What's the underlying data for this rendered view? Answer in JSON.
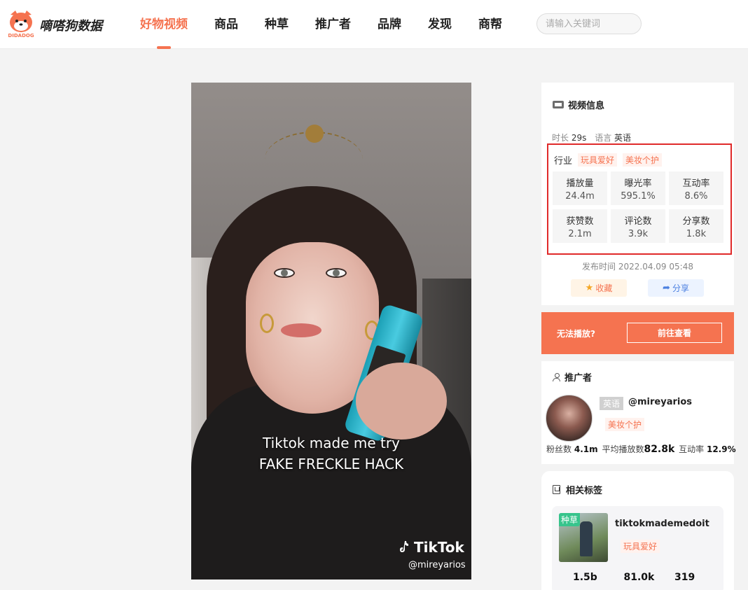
{
  "header": {
    "logo_text": "嘀嗒狗数据",
    "logo_sub": "DIDADOG",
    "nav": [
      {
        "label": "好物视频",
        "active": true
      },
      {
        "label": "商品",
        "active": false
      },
      {
        "label": "种草",
        "active": false
      },
      {
        "label": "推广者",
        "active": false
      },
      {
        "label": "品牌",
        "active": false
      },
      {
        "label": "发现",
        "active": false
      },
      {
        "label": "商帮",
        "active": false
      }
    ],
    "search_placeholder": "请输入关键词"
  },
  "video": {
    "caption_line1": "Tiktok made me try",
    "caption_line2": "FAKE FRECKLE HACK",
    "watermark": "TikTok",
    "watermark_user": "@mireyarios"
  },
  "video_info": {
    "title": "视频信息",
    "duration_label": "时长",
    "duration": "29s",
    "language_label": "语言",
    "language": "英语",
    "industry_label": "行业",
    "industry_tags": [
      "玩具爱好",
      "美妆个护"
    ],
    "stats": [
      {
        "label": "播放量",
        "value": "24.4m"
      },
      {
        "label": "曝光率",
        "value": "595.1%"
      },
      {
        "label": "互动率",
        "value": "8.6%"
      },
      {
        "label": "获赞数",
        "value": "2.1m"
      },
      {
        "label": "评论数",
        "value": "3.9k"
      },
      {
        "label": "分享数",
        "value": "1.8k"
      }
    ],
    "publish_label": "发布时间",
    "publish_time": "2022.04.09 05:48",
    "favorite_label": "收藏",
    "share_label": "分享"
  },
  "play_bar": {
    "text": "无法播放?",
    "button": "前往查看"
  },
  "promoter": {
    "title": "推广者",
    "language": "英语",
    "handle": "@mireyarios",
    "tag": "美妆个护",
    "fans_label": "粉丝数",
    "fans": "4.1m",
    "avg_play_label": "平均播放数",
    "avg_play": "82.8k",
    "engagement_label": "互动率",
    "engagement": "12.9%"
  },
  "related_tags": {
    "title": "相关标签",
    "card": {
      "badge": "种草",
      "name": "tiktokmademedoit",
      "tag": "玩具爱好",
      "stats": [
        "1.5b",
        "81.0k",
        "319"
      ]
    }
  },
  "colors": {
    "accent": "#f57350",
    "highlight_border": "#e02a2a",
    "seed_badge": "#37c48c",
    "share_blue": "#4a7fe0"
  }
}
